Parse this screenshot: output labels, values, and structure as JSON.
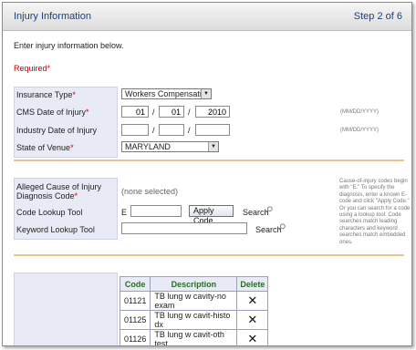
{
  "header": {
    "title": "Injury Information",
    "step": "Step 2 of 6"
  },
  "intro": "Enter injury information below.",
  "required_label": "Required",
  "required_star": "*",
  "fields": {
    "insurance_type": {
      "label": "Insurance Type",
      "value": "Workers Compensation"
    },
    "cms_date": {
      "label": "CMS Date of Injury",
      "month": "01",
      "day": "01",
      "year": "2010",
      "format": "(MM/DD/YYYY)"
    },
    "industry_date": {
      "label": "Industry Date of Injury",
      "month": "",
      "day": "",
      "year": "",
      "format": "(MM/DD/YYYY)"
    },
    "state_of_venue": {
      "label": "State of Venue",
      "value": "MARYLAND"
    }
  },
  "date_sep": "/",
  "cause": {
    "label_line1": "Alleged Cause of Injury",
    "label_line2": "Diagnosis Code",
    "value": "(none selected)",
    "help": [
      "Cause-of-injury codes begin",
      "with \"E.\" To specify the",
      "diagnosis, enter a known E-",
      "code and click \"Apply Code.\"",
      "Or you can search for a code",
      "using a lookup tool. Code",
      "searches match leading",
      "characters and keyword",
      "searches match embedded",
      "ones."
    ]
  },
  "code_lookup": {
    "label": "Code Lookup Tool",
    "prefix": "E",
    "value": "",
    "apply_label": "Apply Code",
    "search_label": "Search"
  },
  "keyword_lookup": {
    "label": "Keyword Lookup Tool",
    "value": "",
    "search_label": "Search"
  },
  "table": {
    "headers": [
      "Code",
      "Description",
      "Delete"
    ],
    "rows": [
      {
        "code": "01121",
        "description": "TB lung w cavity-no exam",
        "delete": "✕"
      },
      {
        "code": "01125",
        "description": "TB lung w cavit-histo dx",
        "delete": "✕"
      },
      {
        "code": "01126",
        "description": "TB lung w cavit-oth test",
        "delete": "✕"
      }
    ]
  }
}
